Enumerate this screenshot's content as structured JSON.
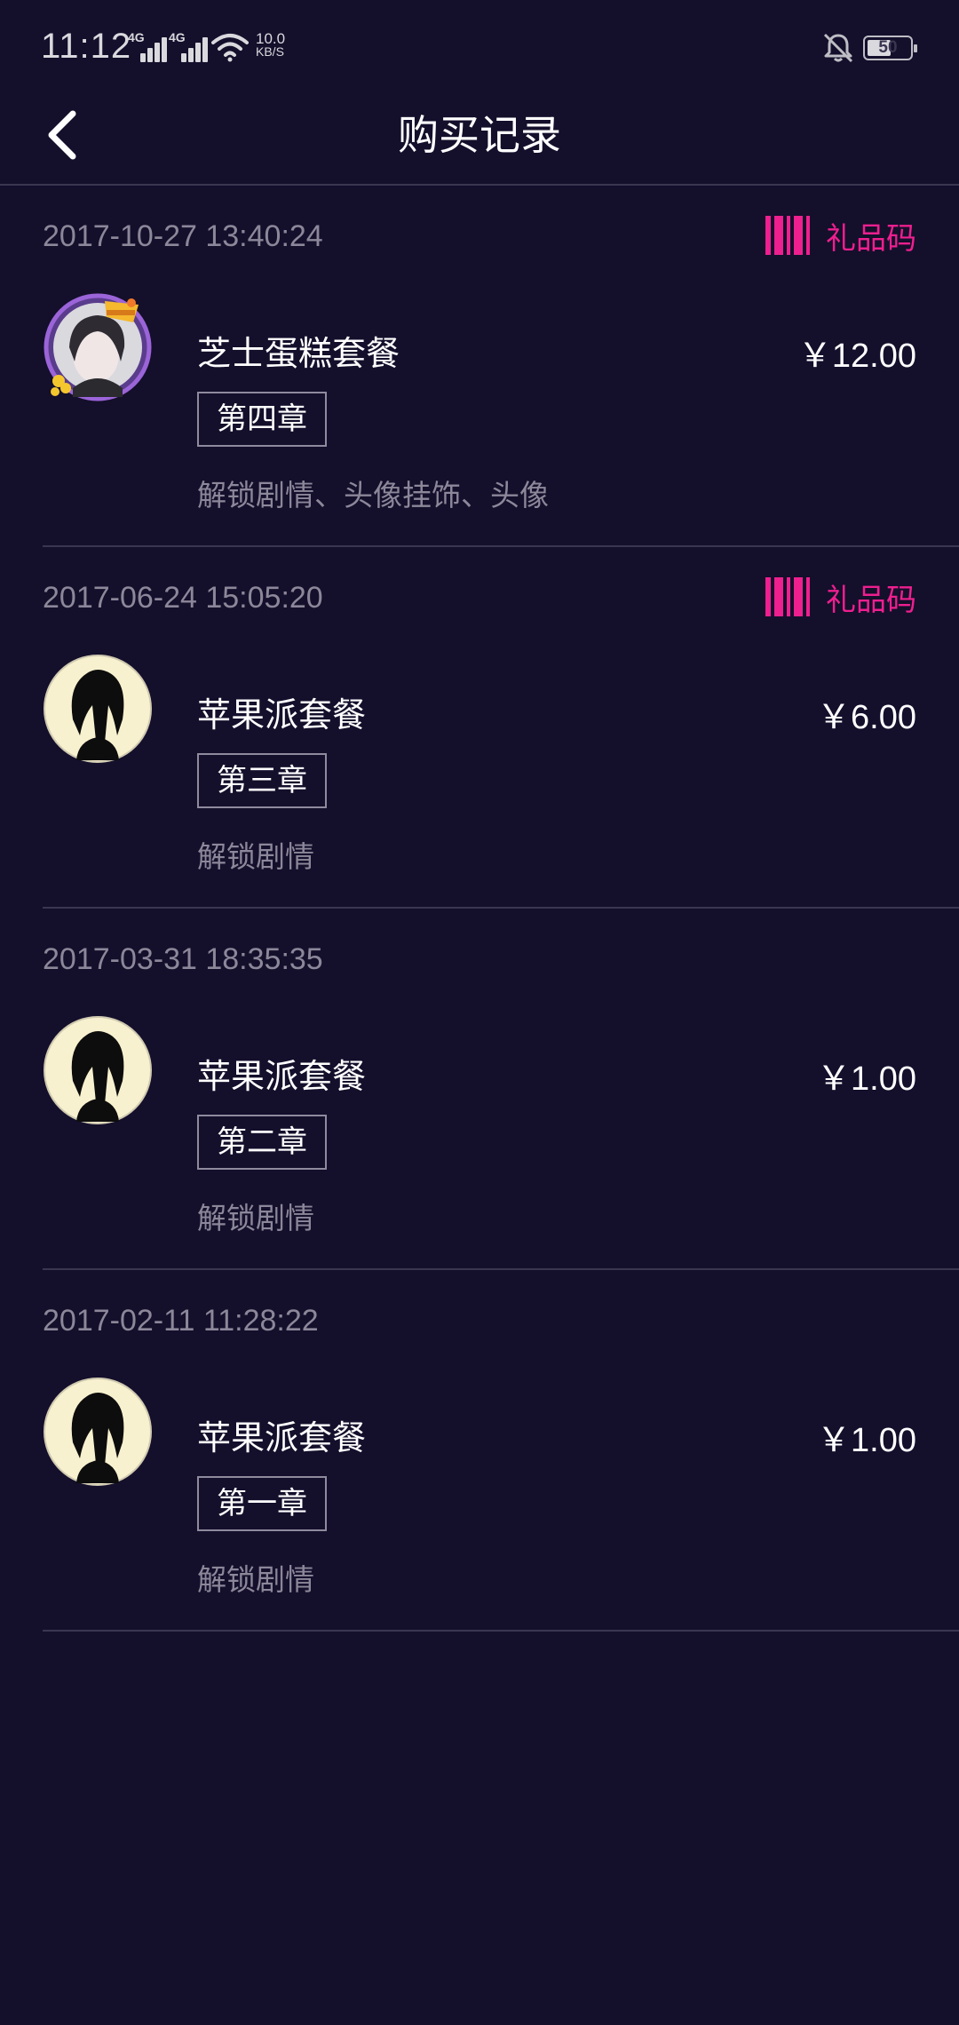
{
  "status_bar": {
    "time": "11:12",
    "network_1": "4G",
    "network_2": "4G",
    "speed_value": "10.0",
    "speed_unit": "KB/S",
    "battery_level": "50"
  },
  "header": {
    "title": "购买记录"
  },
  "gift_code_label": "礼品码",
  "records": [
    {
      "time": "2017-10-27 13:40:24",
      "has_gift_code": true,
      "name": "芝士蛋糕套餐",
      "price": "￥12.00",
      "chapter": "第四章",
      "unlock": "解锁剧情、头像挂饰、头像",
      "avatar": "decorated-avatar"
    },
    {
      "time": "2017-06-24 15:05:20",
      "has_gift_code": true,
      "name": "苹果派套餐",
      "price": "￥6.00",
      "chapter": "第三章",
      "unlock": "解锁剧情",
      "avatar": "silhouette-avatar"
    },
    {
      "time": "2017-03-31 18:35:35",
      "has_gift_code": false,
      "name": "苹果派套餐",
      "price": "￥1.00",
      "chapter": "第二章",
      "unlock": "解锁剧情",
      "avatar": "silhouette-avatar"
    },
    {
      "time": "2017-02-11 11:28:22",
      "has_gift_code": false,
      "name": "苹果派套餐",
      "price": "￥1.00",
      "chapter": "第一章",
      "unlock": "解锁剧情",
      "avatar": "silhouette-avatar"
    }
  ],
  "colors": {
    "background": "#140f2b",
    "accent": "#ee1f8f",
    "muted_text": "#8c8799",
    "divider": "#3b3650"
  }
}
